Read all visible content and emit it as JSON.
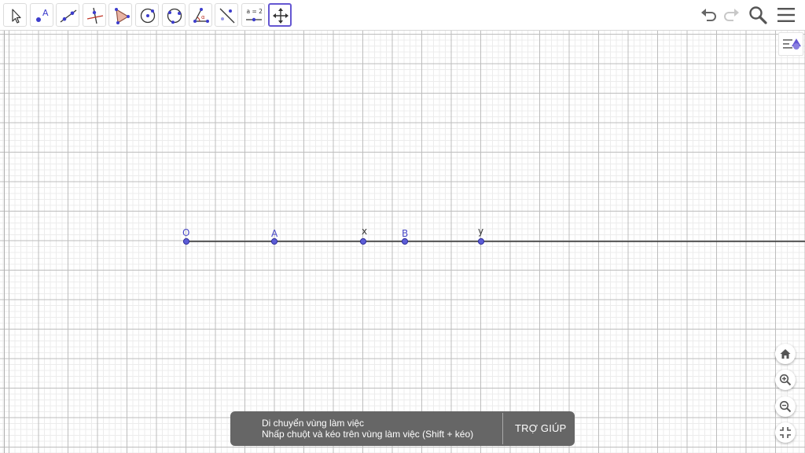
{
  "toolbar": {
    "tools": [
      {
        "name": "move-tool",
        "icon": "arrow-cursor-icon",
        "active": false
      },
      {
        "name": "point-tool",
        "icon": "point-icon",
        "label": "A",
        "active": false
      },
      {
        "name": "line-tool",
        "icon": "line-icon",
        "active": false
      },
      {
        "name": "perpendicular-line-tool",
        "icon": "perpendicular-line-icon",
        "active": false
      },
      {
        "name": "polygon-tool",
        "icon": "polygon-icon",
        "active": false
      },
      {
        "name": "circle-tool",
        "icon": "circle-center-point-icon",
        "active": false
      },
      {
        "name": "circle-three-points-tool",
        "icon": "circle-three-points-icon",
        "active": false
      },
      {
        "name": "angle-tool",
        "icon": "angle-icon",
        "label": "α",
        "active": false
      },
      {
        "name": "reflect-tool",
        "icon": "reflect-about-line-icon",
        "active": false
      },
      {
        "name": "slider-tool",
        "icon": "slider-icon",
        "label": "a = 2",
        "active": false
      },
      {
        "name": "move-graphics-view-tool",
        "icon": "move-arrows-icon",
        "active": true
      }
    ],
    "right": [
      {
        "name": "undo-button",
        "icon": "undo-icon"
      },
      {
        "name": "redo-button",
        "icon": "redo-icon"
      },
      {
        "name": "search-button",
        "icon": "search-icon"
      },
      {
        "name": "menu-button",
        "icon": "hamburger-menu-icon"
      }
    ]
  },
  "graphics": {
    "style_bar_icon": "style-bar-toggle-icon",
    "points": [
      {
        "label": "O",
        "labeled": true
      },
      {
        "label": "A",
        "labeled": true
      },
      {
        "label": "x",
        "labeled": false
      },
      {
        "label": "B",
        "labeled": true
      },
      {
        "label": "y",
        "labeled": false
      }
    ],
    "point_color": "#5c5cd6",
    "label_color": "#4a4ac8",
    "line_color": "#333333"
  },
  "zoom_controls": [
    {
      "name": "standard-view-button",
      "icon": "home-icon"
    },
    {
      "name": "zoom-in-button",
      "icon": "zoom-in-icon"
    },
    {
      "name": "zoom-out-button",
      "icon": "zoom-out-icon"
    },
    {
      "name": "fullscreen-exit-button",
      "icon": "exit-fullscreen-icon"
    }
  ],
  "tooltip": {
    "title": "Di chuyển vùng làm việc",
    "description": "Nhấp chuột và kéo trên vùng làm việc (Shift + kéo)",
    "help": "TRỢ GIÚP"
  },
  "colors": {
    "accent": "#6557d2",
    "snackbar_bg": "#666666",
    "grid_major": "#bdbdbd",
    "grid_minor": "#ececec"
  }
}
